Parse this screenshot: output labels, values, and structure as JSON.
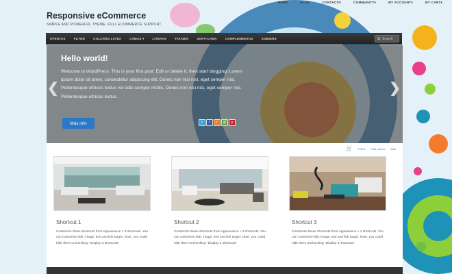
{
  "top_nav": [
    "HOME",
    "BLOG",
    "CONTACTO",
    "COMMUNITY▾",
    "MY ACCOUNT▾",
    "MY CART▾"
  ],
  "site": {
    "title": "Responsive eCommerce",
    "tagline": "SIMPLE AND POWERFUL THEME. FULL ECOMMERCE SUPPORT"
  },
  "menu": [
    "OFERTAS",
    "FUTON",
    "COLCHÓN LATEX",
    "CAMAS ▾",
    "LITERAS",
    "TATAMIS",
    "SOFÁ-CAMA",
    "COMPLEMENTOS",
    "SOMIERS"
  ],
  "search": {
    "label": "Search"
  },
  "slider": {
    "title": "Hello world!",
    "text": "Welcome to WordPress. This is your first post. Edit or delete it, then start blogging! Lorem ipsum dolor sit amet, consectetur adipiscing elit. Donec non nisi nisl, eget semper nisl. Pellentesque ultrices lectus vel odio semper mollis. Donec non nisi nisl, eget semper nisl. Pellentesque ultrices lectus.",
    "button": "Más info",
    "prev_arrow": "❮",
    "next_arrow": "❯",
    "share_icons": [
      "twitter-icon",
      "facebook-icon",
      "rss-icon",
      "email-icon",
      "pinterest-icon"
    ]
  },
  "cart": {
    "total": "0.00 €",
    "greeting": "Hola, aroha",
    "logout": "Salir"
  },
  "shortcuts": [
    {
      "title": "Shortcut 1",
      "text": "Customize these shortcuts from Appearance > 3 shortcuts. You can customize title, image, text and link target. Note, you could hide them unchecking \"Display 3 shortcuts\""
    },
    {
      "title": "Shortcut 2",
      "text": "Customize these shortcuts from Appearance > 3 shortcuts. You can customize title, image, text and link target. Note, you could hide them unchecking \"Display 3 shortcuts\""
    },
    {
      "title": "Shortcut 3",
      "text": "Customize these shortcuts from Appearance > 3 shortcuts. You can customize title, image, text and link target. Note, you could hide them unchecking \"Display 3 shortcuts\""
    }
  ],
  "colors": {
    "accent": "#2a78c8",
    "menubar": "#2b2b2b",
    "background": "#e4f1f8"
  }
}
